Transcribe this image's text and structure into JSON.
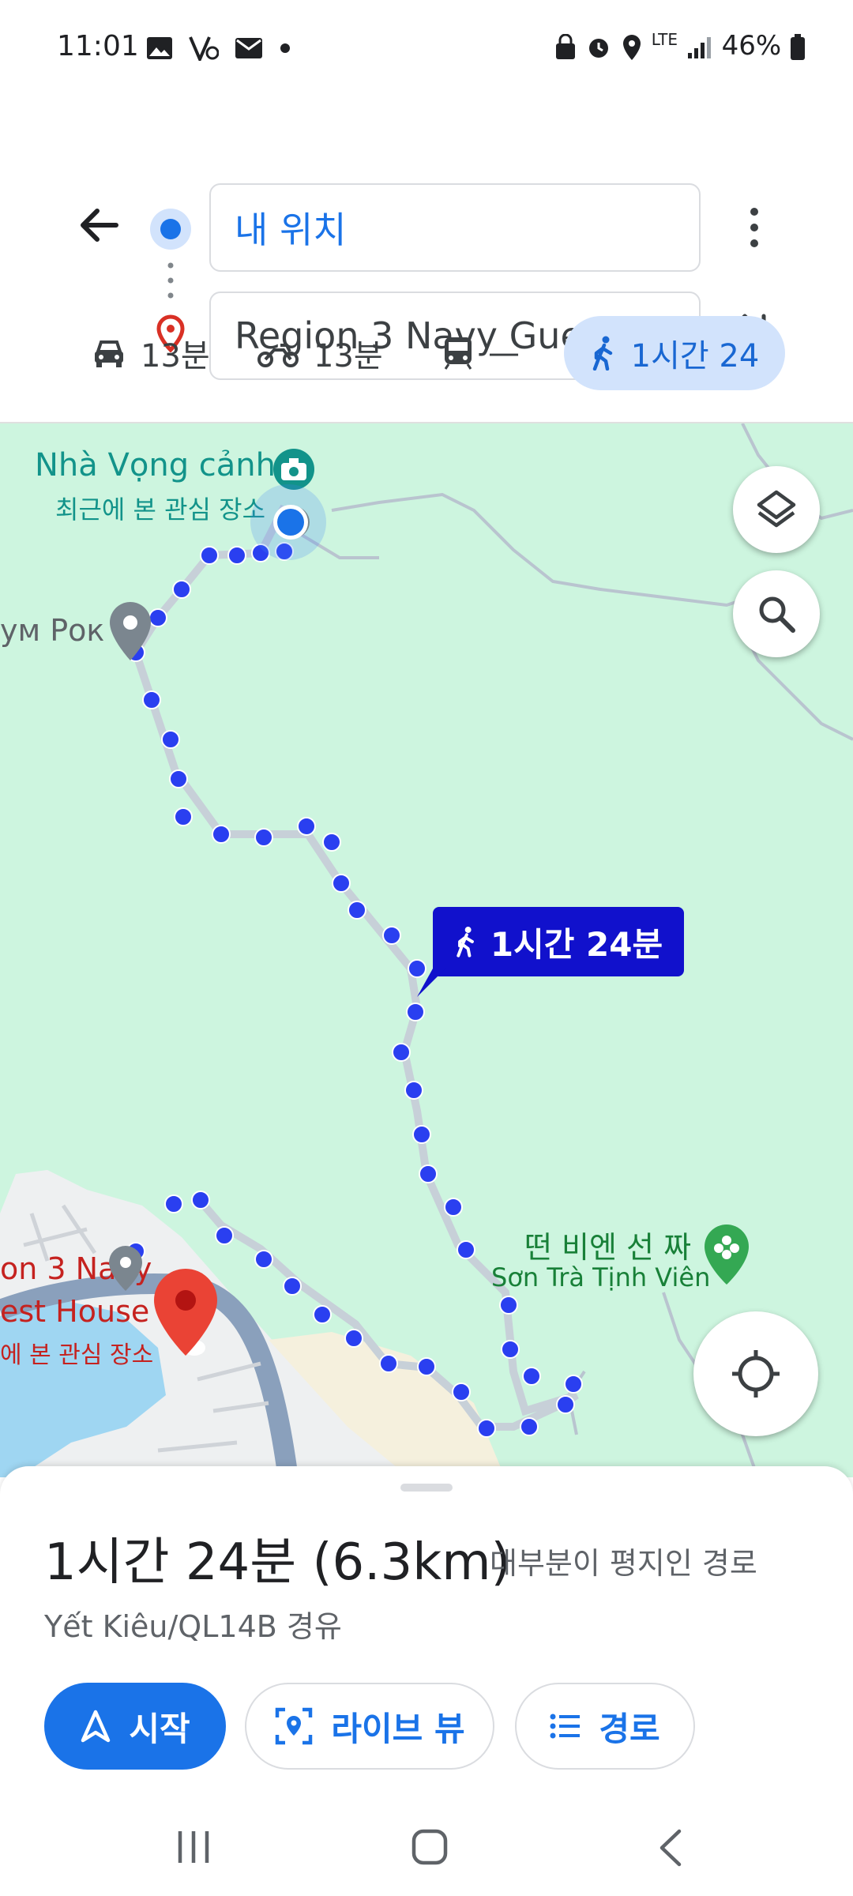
{
  "status_bar": {
    "time": "11:01",
    "battery": "46%",
    "network": "LTE",
    "left_icons": [
      "gallery-icon",
      "vpn-icon",
      "mail-icon",
      "dot-icon"
    ],
    "right_icons": [
      "lock-icon",
      "alarm-icon",
      "location-icon",
      "signal-icon",
      "battery-icon"
    ]
  },
  "directions": {
    "from": "내 위치",
    "to": "Region 3 Navy Guest H..."
  },
  "modes": [
    {
      "icon": "car-icon",
      "label": "13분"
    },
    {
      "icon": "motorcycle-icon",
      "label": "13분"
    },
    {
      "icon": "transit-icon",
      "label": "—"
    },
    {
      "icon": "walk-icon",
      "label": "1시간 24",
      "selected": true
    }
  ],
  "map": {
    "poi_top_name": "Nhà Vọng cảnh",
    "poi_top_sub": "최근에 본 관심 장소",
    "poi_left_name": "ум Рок",
    "poi_right_name_ko": "떤 비엔 선 짜",
    "poi_right_name": "Sơn Trà Tịnh Viên",
    "dest_name_1": "on 3 Navy",
    "dest_name_2": "est House",
    "dest_sub": "에 본 관심 장소",
    "route_label": "1시간 24분",
    "colors": {
      "route": "#2a3ff0",
      "map_bg": "#cdf5df",
      "badge": "#1111cc",
      "poi_teal": "#12938a",
      "poi_green": "#188038",
      "dest_red": "#c5221f"
    }
  },
  "sheet": {
    "duration": "1시간 24분 (6.3km)",
    "duration_note": "대부분이 평지인 경로",
    "via": "Yết Kiêu/QL14B 경유",
    "start_label": "시작",
    "live_view_label": "라이브 뷰",
    "steps_label": "경로"
  }
}
